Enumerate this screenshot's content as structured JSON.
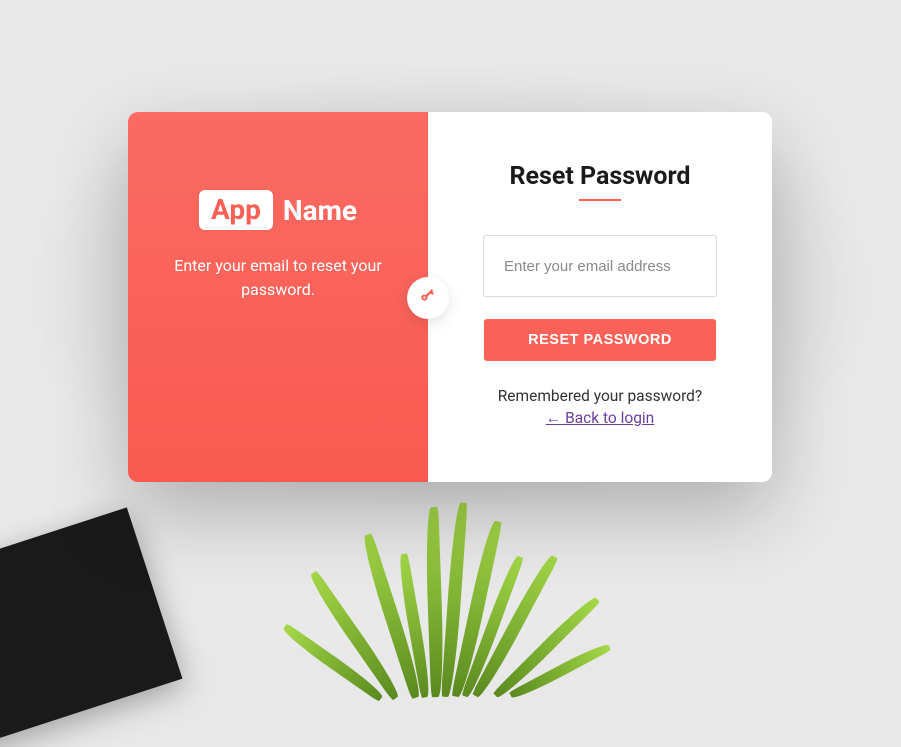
{
  "colors": {
    "accent": "#fa6159",
    "link": "#6b3fa0"
  },
  "left_panel": {
    "logo_badge": "App",
    "logo_name": "Name",
    "subtitle": "Enter your email to reset your password."
  },
  "form": {
    "title": "Reset Password",
    "email_placeholder": "Enter your email address",
    "email_value": "",
    "submit_label": "RESET PASSWORD",
    "remembered_text": "Remembered your password?",
    "back_link_text": "← Back to login"
  }
}
